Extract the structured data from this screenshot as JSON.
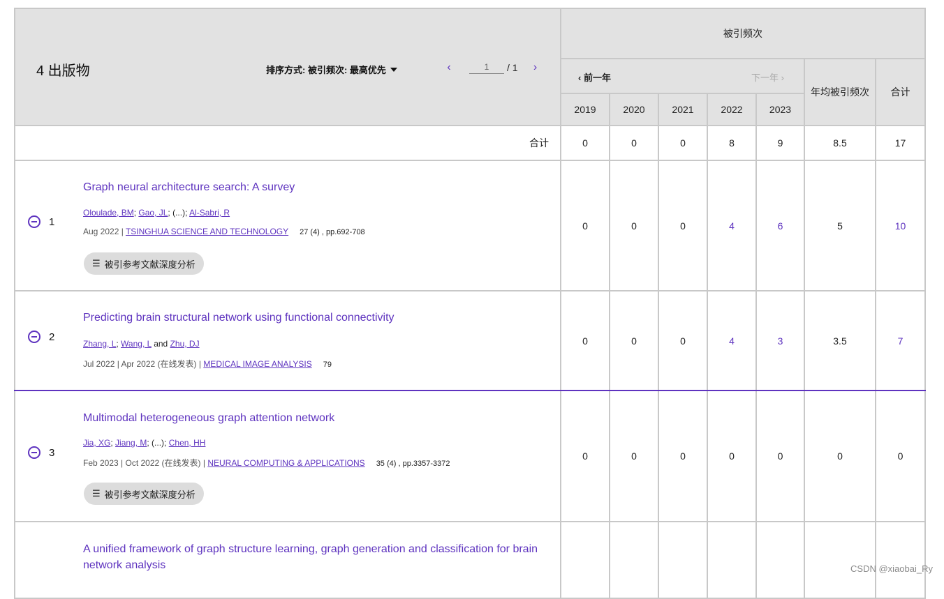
{
  "header": {
    "pub_count": "4 出版物",
    "sort_label": "排序方式: 被引频次: 最高优先",
    "page_value": "1",
    "page_of": "/ 1",
    "cited_title": "被引频次",
    "prev_year": "前一年",
    "next_year": "下一年",
    "years": [
      "2019",
      "2020",
      "2021",
      "2022",
      "2023"
    ],
    "avg_label": "年均被引频次",
    "total_label": "合计"
  },
  "totals": {
    "label": "合计",
    "values": [
      "0",
      "0",
      "0",
      "8",
      "9",
      "8.5",
      "17"
    ]
  },
  "publications": [
    {
      "index": "1",
      "title": "Graph neural architecture search: A survey",
      "authors": [
        "Oloulade, BM",
        "Gao, JL",
        "Al-Sabri, R"
      ],
      "author_sep1": "; ",
      "author_mid": "; (...); ",
      "date": "Aug 2022 | ",
      "journal": "TSINGHUA SCIENCE AND TECHNOLOGY",
      "volume": "27 (4) , pp.692-708",
      "button": "被引参考文献深度分析",
      "counts": [
        "0",
        "0",
        "0",
        "4",
        "6",
        "5",
        "10"
      ]
    },
    {
      "index": "2",
      "title": "Predicting brain structural network using functional connectivity",
      "authors": [
        "Zhang, L",
        "Wang, L",
        "Zhu, DJ"
      ],
      "author_sep1": "; ",
      "author_mid": " and ",
      "date": "Jul 2022 | Apr 2022 (在线发表) | ",
      "journal": "MEDICAL IMAGE ANALYSIS",
      "volume": "79",
      "counts": [
        "0",
        "0",
        "0",
        "4",
        "3",
        "3.5",
        "7"
      ]
    },
    {
      "index": "3",
      "title": "Multimodal heterogeneous graph attention network",
      "authors": [
        "Jia, XG",
        "Jiang, M",
        "Chen, HH"
      ],
      "author_sep1": "; ",
      "author_mid": "; (...); ",
      "date": "Feb 2023 | Oct 2022 (在线发表) | ",
      "journal": "NEURAL COMPUTING & APPLICATIONS",
      "volume": "35 (4) , pp.3357-3372",
      "button": "被引参考文献深度分析",
      "counts": [
        "0",
        "0",
        "0",
        "0",
        "0",
        "0",
        "0"
      ]
    },
    {
      "title": "A unified framework of graph structure learning, graph generation and classification for brain network analysis"
    }
  ],
  "watermark": "CSDN @xiaobai_Ry"
}
